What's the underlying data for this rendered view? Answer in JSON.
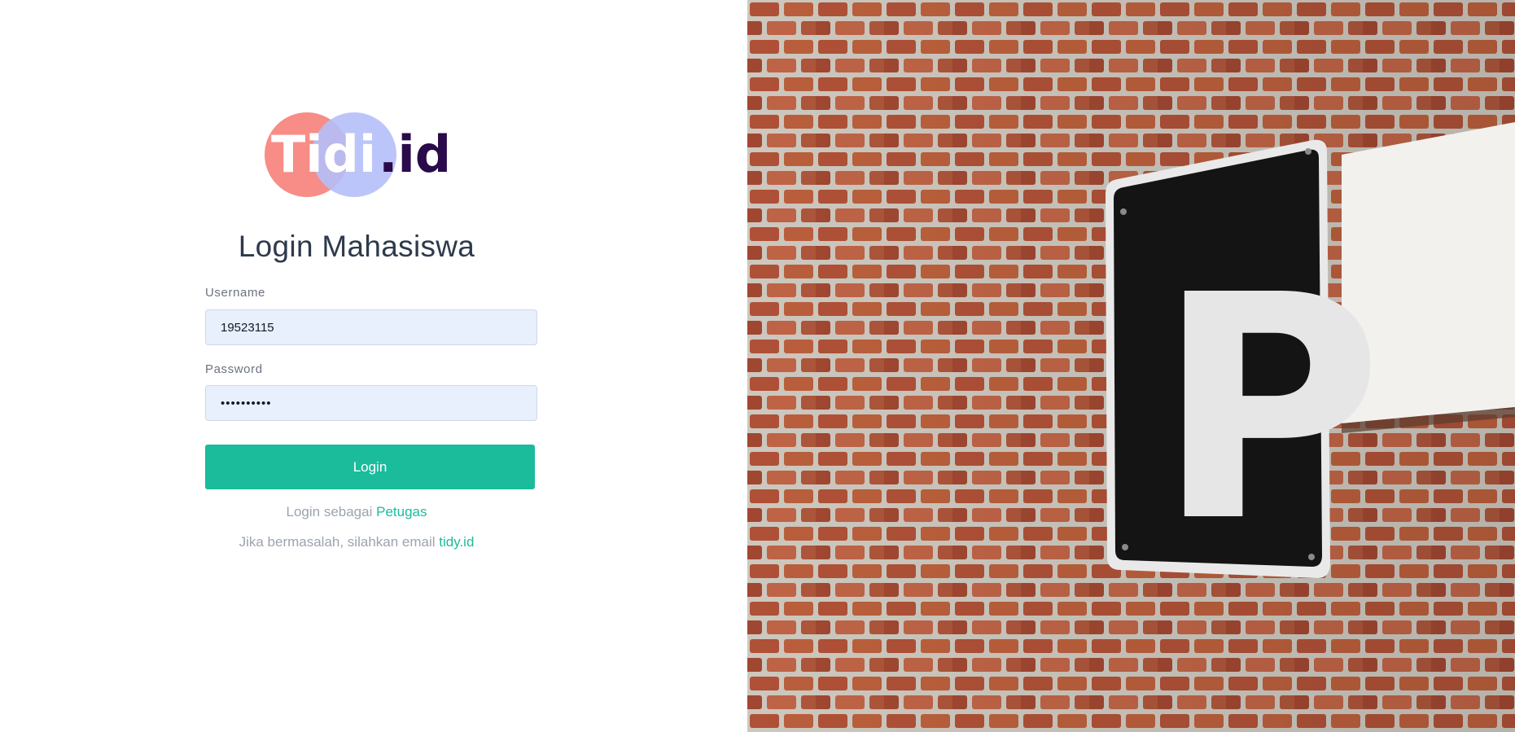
{
  "brand": {
    "logo_text": "Tidi.id"
  },
  "login": {
    "title": "Login Mahasiswa",
    "username_label": "Username",
    "username_value": "19523115",
    "password_label": "Password",
    "password_value": "••••••••••",
    "button_label": "Login"
  },
  "alt_login": {
    "prefix": "Login sebagai",
    "link_label": "Petugas"
  },
  "help": {
    "prefix": "Jika bermasalah, silahkan email",
    "link_label": "tidy.id"
  },
  "photo": {
    "sign_letter": "P"
  },
  "colors": {
    "accent": "#1abc9c",
    "input_bg": "#e8f0fe",
    "title": "#2d3a4b",
    "logo_circle_left": "#f7877f",
    "logo_circle_right": "#b4bffa",
    "logo_dark": "#2a0a4a"
  }
}
